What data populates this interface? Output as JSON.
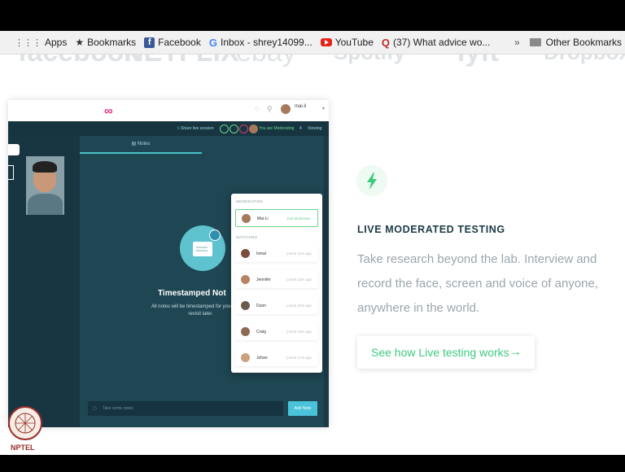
{
  "bookmarks": {
    "items": [
      {
        "label": "Apps",
        "icon": "apps-grid-icon"
      },
      {
        "label": "Bookmarks",
        "icon": "star-icon"
      },
      {
        "label": "Facebook",
        "icon": "facebook-icon"
      },
      {
        "label": "Inbox - shrey14099...",
        "icon": "google-icon"
      },
      {
        "label": "YouTube",
        "icon": "youtube-icon"
      },
      {
        "label": "(37) What advice wo...",
        "icon": "quora-icon"
      }
    ],
    "overflow": "»",
    "other_bookmarks": "Other Bookmarks"
  },
  "logos": [
    "facebook",
    "NETFLIX",
    "ebay",
    "Spotify",
    "lyft",
    "Dropbox"
  ],
  "app": {
    "user_name": "mai-li",
    "status": {
      "share": "Share live session",
      "moderating": "You are Moderating",
      "count": "4",
      "viewing": "Viewing"
    },
    "notes_tab": "Notes",
    "timestamped_title": "Timestamped Not",
    "timestamped_desc": "All notes will be timestamped for your team to revisit later.",
    "note_placeholder": "Take some notes",
    "add_note": "Add Note",
    "viewers": {
      "moderating_label": "MODERATING",
      "moderator": {
        "name": "Mai-Li",
        "action": "Exit Moderator"
      },
      "watching_label": "WATCHING",
      "watching": [
        {
          "name": "Ismal",
          "time": "joined 22m ago"
        },
        {
          "name": "Jennifer",
          "time": "joined 22m ago"
        },
        {
          "name": "Dunn",
          "time": "joined 20m ago"
        },
        {
          "name": "Craig",
          "time": "joined 19m ago"
        },
        {
          "name": "Johan",
          "time": "joined 17m ago"
        }
      ]
    }
  },
  "section": {
    "heading": "LIVE MODERATED TESTING",
    "body": "Take research beyond the lab. Interview and record the face, screen and voice of anyone, anywhere in the world.",
    "cta": "See how Live testing works",
    "cta_arrow": "→"
  },
  "nptel": "NPTEL",
  "colors": {
    "accent": "#3ccb7f",
    "app_dark": "#1b3a45",
    "brand_pink": "#e3337f"
  }
}
